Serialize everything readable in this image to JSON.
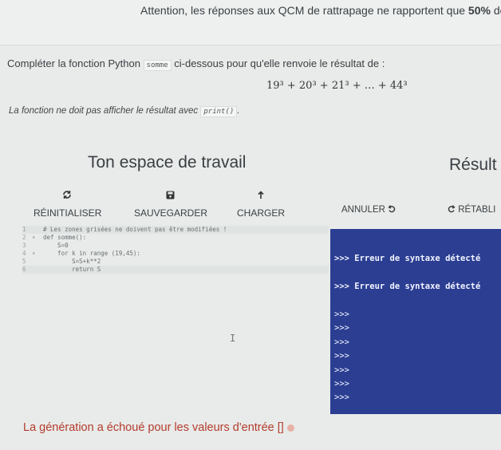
{
  "banner": {
    "text_before": "Attention, les réponses aux QCM de rattrapage ne rapportent que ",
    "text_bold": "50%",
    "text_after": " des p"
  },
  "exercise": {
    "prompt_before": "Compléter la fonction Python ",
    "function_name": "somme",
    "prompt_after": " ci-dessous pour qu'elle renvoie le résultat de :",
    "formula": "19³ + 20³ + 21³ + … + 44³",
    "note_before": "La fonction ne doit pas afficher le résultat avec ",
    "note_code": "print()",
    "note_after": "."
  },
  "workspace": {
    "title": "Ton espace de travail",
    "buttons": {
      "reset": {
        "label": "RÉINITIALISER",
        "icon": "refresh-icon"
      },
      "save": {
        "label": "SAUVEGARDER",
        "icon": "save-icon"
      },
      "load": {
        "label": "CHARGER",
        "icon": "upload-icon"
      }
    },
    "code_lines": [
      {
        "num": "1",
        "fold": "",
        "text": "# Les zones grisées ne doivent pas être modifiées !",
        "shaded": true
      },
      {
        "num": "2",
        "fold": "▾",
        "text": "def somme():",
        "shaded": false
      },
      {
        "num": "3",
        "fold": "",
        "text": "    S=0",
        "shaded": false
      },
      {
        "num": "4",
        "fold": "▾",
        "text": "    for k in range (19,45):",
        "shaded": false
      },
      {
        "num": "5",
        "fold": "",
        "text": "        S=S+k**2",
        "shaded": false
      },
      {
        "num": "6",
        "fold": "",
        "text": "        return S",
        "shaded": true
      }
    ]
  },
  "result": {
    "title": "Résult",
    "cancel_label": "ANNULER",
    "restore_label": "RÉTABLI",
    "console_lines": [
      {
        "text": ">>> Erreur de syntaxe détecté",
        "error": true
      },
      {
        "text": ">>> Erreur de syntaxe détecté",
        "error": true
      },
      {
        "text": ">>>",
        "error": false
      },
      {
        "text": ">>>",
        "error": false
      },
      {
        "text": ">>>",
        "error": false
      },
      {
        "text": ">>>",
        "error": false
      },
      {
        "text": ">>>",
        "error": false
      },
      {
        "text": ">>>",
        "error": false
      },
      {
        "text": ">>>",
        "error": false
      }
    ]
  },
  "status": {
    "failure_message": "La génération a échoué pour les valeurs d'entrée []"
  },
  "colors": {
    "console_bg": "#2b3e92",
    "failure_text": "#b43c2e"
  }
}
